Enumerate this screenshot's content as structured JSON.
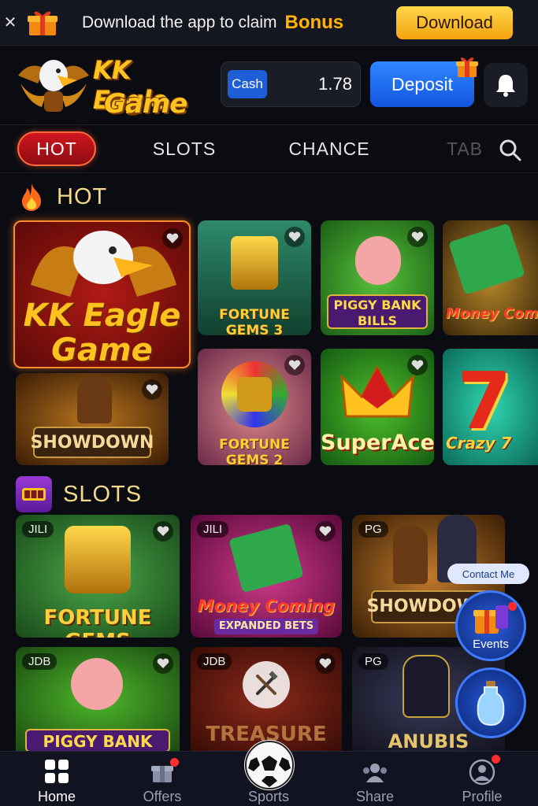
{
  "promo": {
    "message": "Download the app to claim",
    "bonus": "Bonus",
    "download_label": "Download",
    "close_icon": "close-icon",
    "gift_icon": "gift-icon"
  },
  "header": {
    "logo_line1": "KK Eagle",
    "logo_line2": "Game",
    "cash_label": "Cash",
    "balance": "1.78",
    "deposit_label": "Deposit"
  },
  "tabs": [
    {
      "label": "HOT",
      "active": true
    },
    {
      "label": "SLOTS"
    },
    {
      "label": "CHANCE"
    },
    {
      "label": "TAB"
    }
  ],
  "sections": {
    "hot_title": "HOT",
    "slots_title": "SLOTS"
  },
  "hot_games": [
    {
      "title_line1": "KK Eagle",
      "title_line2": "Game"
    },
    {
      "title": "FORTUNE GEMS 3"
    },
    {
      "title_line1": "PIGGY BANK",
      "title_line2": "BILLS"
    },
    {
      "title": "Money Coming"
    },
    {
      "title": "SHOWDOWN"
    },
    {
      "title": "FORTUNE GEMS 2"
    },
    {
      "title": "SuperAce"
    },
    {
      "title": "Crazy 7"
    }
  ],
  "slot_games": [
    {
      "provider": "JILI",
      "title": "FORTUNE GEMS"
    },
    {
      "provider": "JILI",
      "title": "Money Coming",
      "subtitle": "EXPANDED BETS"
    },
    {
      "provider": "PG",
      "title": "SHOWDOWN"
    },
    {
      "provider": "JDB",
      "title": "PIGGY BANK"
    },
    {
      "provider": "JDB",
      "title": "TREASURE"
    },
    {
      "provider": "PG",
      "title": "ANUBIS"
    }
  ],
  "floating": {
    "contact_label": "Contact Me",
    "events_label": "Events"
  },
  "nav": [
    {
      "label": "Home",
      "active": true
    },
    {
      "label": "Offers"
    },
    {
      "label": "Sports"
    },
    {
      "label": "Share"
    },
    {
      "label": "Profile"
    }
  ],
  "colors": {
    "background": "#0b0c12",
    "accent_gold": "#ffb400",
    "primary_blue": "#1e5ed6",
    "hot_red": "#d0161e"
  }
}
